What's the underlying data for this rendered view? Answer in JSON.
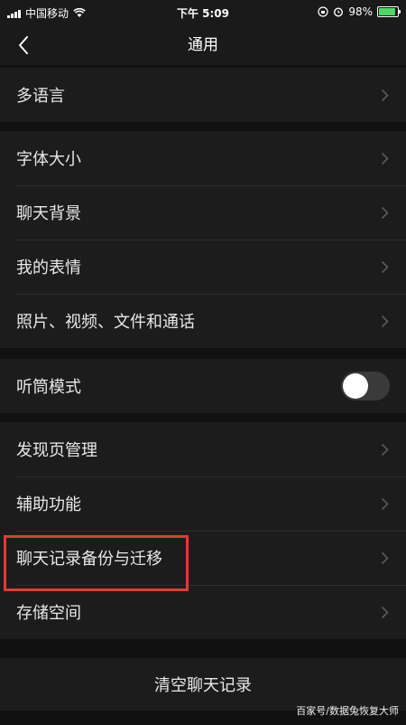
{
  "status": {
    "carrier": "中国移动",
    "time": "下午 5:09",
    "battery": "98%",
    "battery_level": 0.98
  },
  "nav": {
    "title": "通用"
  },
  "groups": [
    {
      "items": [
        {
          "label": "多语言"
        }
      ]
    },
    {
      "items": [
        {
          "label": "字体大小"
        },
        {
          "label": "聊天背景"
        },
        {
          "label": "我的表情"
        },
        {
          "label": "照片、视频、文件和通话"
        }
      ]
    },
    {
      "items": [
        {
          "label": "听筒模式",
          "toggle": false
        }
      ]
    },
    {
      "items": [
        {
          "label": "发现页管理"
        },
        {
          "label": "辅助功能"
        },
        {
          "label": "聊天记录备份与迁移"
        },
        {
          "label": "存储空间"
        }
      ]
    }
  ],
  "clear_history": "清空聊天记录",
  "watermark": "百家号/数据兔恢复大师",
  "colors": {
    "background": "#111111",
    "cell": "#1c1c1c",
    "highlight": "#e53935"
  }
}
